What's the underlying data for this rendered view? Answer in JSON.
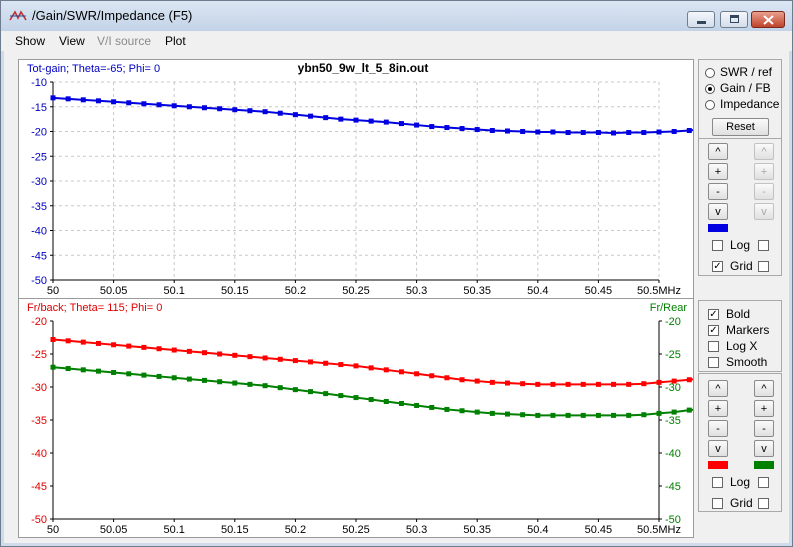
{
  "window": {
    "title": "/Gain/SWR/Impedance (F5)"
  },
  "menu": [
    "Show",
    "View",
    "V/I source",
    "Plot"
  ],
  "menu_disabled": [
    false,
    false,
    true,
    false
  ],
  "controls": {
    "radios": [
      {
        "label": "SWR / ref",
        "selected": false
      },
      {
        "label": "Gain / FB",
        "selected": true
      },
      {
        "label": "Impedance",
        "selected": false
      }
    ],
    "reset_label": "Reset",
    "up_label": "^",
    "plus_label": "+",
    "minus_label": "-",
    "down_label": "v",
    "top": {
      "log_label": "Log",
      "log_checked": false,
      "log2_checked": false,
      "grid_label": "Grid",
      "grid_checked": true,
      "grid2_checked": false,
      "swatch_left": "#0000e0"
    },
    "options": [
      {
        "label": "Bold",
        "checked": true
      },
      {
        "label": "Markers",
        "checked": true
      },
      {
        "label": "Log X",
        "checked": false
      },
      {
        "label": "Smooth",
        "checked": false
      }
    ],
    "bottom": {
      "log_label": "Log",
      "log_checked": false,
      "log2_checked": false,
      "grid_label": "Grid",
      "grid_checked": false,
      "grid2_checked": false,
      "swatch_left": "#ff0000",
      "swatch_right": "#008000"
    }
  },
  "chart_data": [
    {
      "type": "line",
      "title": "ybn50_9w_lt_5_8in.out",
      "ylabel": "Tot-gain; Theta=-65; Phi= 0",
      "x_ticks": [
        "50",
        "50.05",
        "50.1",
        "50.15",
        "50.2",
        "50.25",
        "50.3",
        "50.35",
        "50.4",
        "50.45",
        "50.5MHz"
      ],
      "y_ticks": [
        "-10",
        "-15",
        "-20",
        "-25",
        "-30",
        "-35",
        "-40",
        "-45",
        "-50"
      ],
      "xlim": [
        50,
        50.5
      ],
      "ylim": [
        -50,
        -10
      ],
      "grid": true,
      "x_step": 0.0125,
      "series": [
        {
          "name": "Tot-gain",
          "color": "#0000e0",
          "values": [
            -13.2,
            -13.4,
            -13.6,
            -13.8,
            -14.0,
            -14.2,
            -14.4,
            -14.6,
            -14.8,
            -15.0,
            -15.2,
            -15.4,
            -15.6,
            -15.8,
            -16.0,
            -16.3,
            -16.6,
            -16.9,
            -17.2,
            -17.5,
            -17.7,
            -17.9,
            -18.1,
            -18.4,
            -18.7,
            -19.0,
            -19.2,
            -19.4,
            -19.6,
            -19.8,
            -19.9,
            -20.0,
            -20.1,
            -20.1,
            -20.2,
            -20.2,
            -20.2,
            -20.3,
            -20.2,
            -20.2,
            -20.1,
            -20.0,
            -19.8,
            -19.5,
            -19.3,
            -19.1,
            -18.9,
            -18.7,
            -18.5
          ]
        }
      ]
    },
    {
      "type": "line",
      "ylabel": "Fr/back; Theta= 115; Phi= 0",
      "ylabel_right": "Fr/Rear",
      "x_ticks": [
        "50",
        "50.05",
        "50.1",
        "50.15",
        "50.2",
        "50.25",
        "50.3",
        "50.35",
        "50.4",
        "50.45",
        "50.5MHz"
      ],
      "y_ticks": [
        "-20",
        "-25",
        "-30",
        "-35",
        "-40",
        "-45",
        "-50"
      ],
      "xlim": [
        50,
        50.5
      ],
      "ylim": [
        -50,
        -20
      ],
      "grid": false,
      "x_step": 0.0125,
      "series": [
        {
          "name": "Fr/back",
          "color": "#ff0000",
          "values": [
            -22.8,
            -23.0,
            -23.2,
            -23.4,
            -23.6,
            -23.8,
            -24.0,
            -24.2,
            -24.4,
            -24.6,
            -24.8,
            -25.0,
            -25.2,
            -25.4,
            -25.6,
            -25.8,
            -26.0,
            -26.2,
            -26.4,
            -26.6,
            -26.8,
            -27.1,
            -27.4,
            -27.7,
            -28.0,
            -28.3,
            -28.6,
            -28.9,
            -29.1,
            -29.3,
            -29.4,
            -29.5,
            -29.6,
            -29.6,
            -29.6,
            -29.6,
            -29.6,
            -29.6,
            -29.6,
            -29.5,
            -29.3,
            -29.1,
            -28.9,
            -28.7,
            -28.5,
            -28.3,
            -28.1,
            -27.9,
            -27.7
          ]
        },
        {
          "name": "Fr/Rear",
          "color": "#008000",
          "values": [
            -27.0,
            -27.2,
            -27.4,
            -27.6,
            -27.8,
            -28.0,
            -28.2,
            -28.4,
            -28.6,
            -28.8,
            -29.0,
            -29.2,
            -29.4,
            -29.6,
            -29.8,
            -30.1,
            -30.4,
            -30.7,
            -31.0,
            -31.3,
            -31.6,
            -31.9,
            -32.2,
            -32.5,
            -32.8,
            -33.1,
            -33.4,
            -33.6,
            -33.8,
            -34.0,
            -34.1,
            -34.2,
            -34.3,
            -34.3,
            -34.3,
            -34.3,
            -34.3,
            -34.3,
            -34.3,
            -34.2,
            -34.0,
            -33.8,
            -33.5,
            -33.3,
            -33.1,
            -32.9,
            -32.7,
            -32.5,
            -32.3
          ]
        }
      ]
    }
  ]
}
